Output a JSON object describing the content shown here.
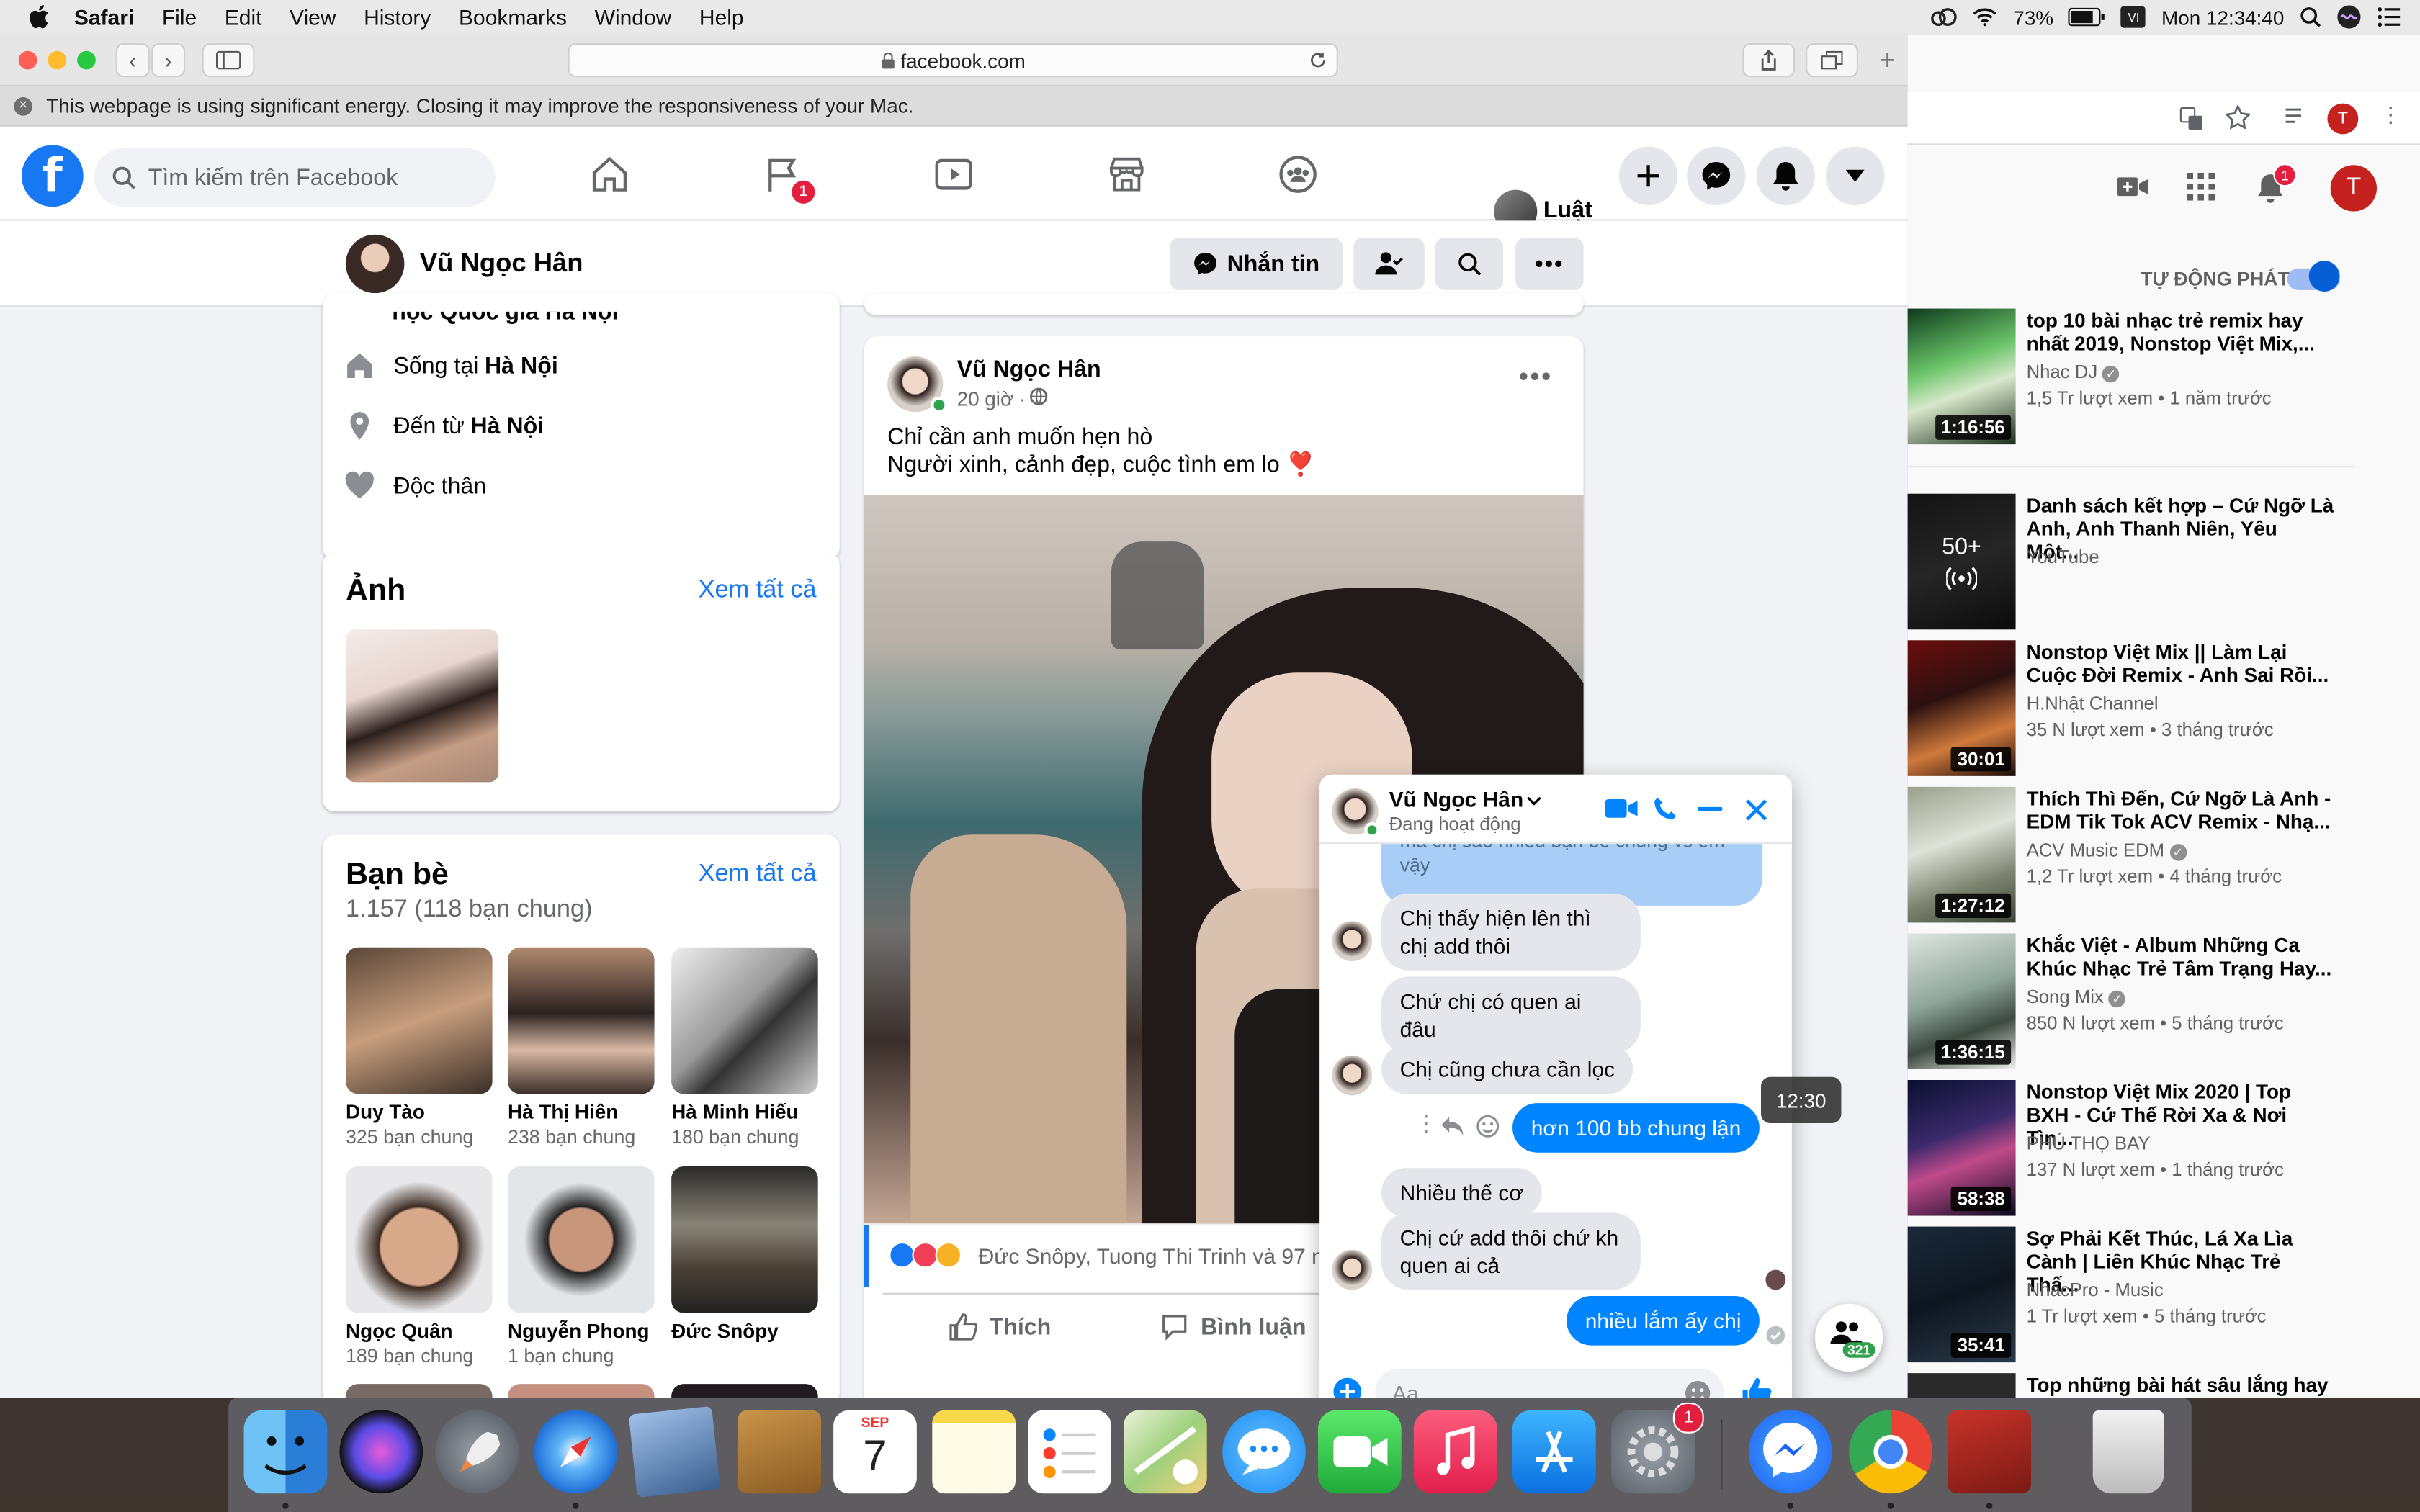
{
  "menubar": {
    "app": "Safari",
    "items": [
      "File",
      "Edit",
      "View",
      "History",
      "Bookmarks",
      "Window",
      "Help"
    ],
    "battery": "73%",
    "clock": "Mon 12:34:40"
  },
  "safari": {
    "url": "facebook.com",
    "energy_warning": "This webpage is using significant energy. Closing it may improve the responsiveness of your Mac."
  },
  "facebook": {
    "search_placeholder": "Tìm kiếm trên Facebook",
    "groups_badge": "1",
    "user_name": "Luật",
    "profile": {
      "name": "Vũ Ngọc Hân",
      "message_button": "Nhắn tin"
    },
    "intro": {
      "cut_line": "học Quốc gia Hà Nội",
      "lives_prefix": "Sống tại ",
      "lives_city": "Hà Nội",
      "from_prefix": "Đến từ ",
      "from_city": "Hà Nội",
      "relationship": "Độc thân"
    },
    "photos": {
      "title": "Ảnh",
      "see_all": "Xem tất cả"
    },
    "friends": {
      "title": "Bạn bè",
      "see_all": "Xem tất cả",
      "count": "1.157 (118 bạn chung)",
      "list": [
        {
          "name": "Duy Tào",
          "mutual": "325 bạn chung"
        },
        {
          "name": "Hà Thị Hiên",
          "mutual": "238 bạn chung"
        },
        {
          "name": "Hà Minh Hiếu",
          "mutual": "180 bạn chung"
        },
        {
          "name": "Ngọc Quân",
          "mutual": "189 bạn chung"
        },
        {
          "name": "Nguyễn Phong",
          "mutual": "1 bạn chung"
        },
        {
          "name": "Đức Snôpy",
          "mutual": ""
        }
      ]
    },
    "post": {
      "author": "Vũ Ngọc Hân",
      "time": "20 giờ ·",
      "line1": "Chỉ cần anh muốn hẹn hò",
      "line2": "Người xinh, cảnh đẹp, cuộc tình em lo ❣️",
      "reactions": "Đức Snôpy, Tuong Thi Trinh và 97 n",
      "like": "Thích",
      "comment": "Bình luận"
    }
  },
  "chat": {
    "name": "Vũ Ngọc Hân",
    "status": "Đang hoạt động",
    "cut_msg": "mà chị sao nhiều bạn bè chung vs em vậy",
    "messages": [
      {
        "dir": "in",
        "text": "Chị thấy hiện lên thì chị add thôi"
      },
      {
        "dir": "in",
        "text": "Chứ chị có quen ai đâu"
      },
      {
        "dir": "in",
        "text": "Chị cũng chưa cần lọc"
      },
      {
        "dir": "out",
        "text": "hơn 100 bb chung lận"
      },
      {
        "dir": "in",
        "text": "Nhiều thế cơ"
      },
      {
        "dir": "in",
        "text": "Chị cứ add thôi chứ kh quen ai cả"
      },
      {
        "dir": "out",
        "text": "nhiều lắm ấy chị"
      }
    ],
    "tooltip_time": "12:30",
    "input_placeholder": "Aa",
    "contacts_count": "321"
  },
  "youtube": {
    "autoplay_label": "TỰ ĐỘNG PHÁT",
    "notif_badge": "1",
    "avatar_letter": "T",
    "videos": [
      {
        "title": "top 10 bài nhạc trẻ remix hay nhất 2019, Nonstop Việt Mix,...",
        "channel": "Nhac DJ",
        "meta": "1,5 Tr lượt xem • 1 năm trước",
        "duration": "1:16:56",
        "verified": true
      },
      {
        "title": "Danh sách kết hợp – Cứ Ngỡ Là Anh, Anh Thanh Niên, Yêu Một...",
        "channel": "YouTube",
        "meta": "",
        "duration": "",
        "mix_count": "50+",
        "verified": false
      },
      {
        "title": "Nonstop Việt Mix || Làm Lại Cuộc Đời Remix - Anh Sai Rồi...",
        "channel": "H.Nhật Channel",
        "meta": "35 N lượt xem • 3 tháng trước",
        "duration": "30:01",
        "verified": false
      },
      {
        "title": "Thích Thì Đến, Cứ Ngỡ Là Anh - EDM Tik Tok ACV Remix - Nhạ...",
        "channel": "ACV Music EDM",
        "meta": "1,2 Tr lượt xem • 4 tháng trước",
        "duration": "1:27:12",
        "verified": true
      },
      {
        "title": "Khắc Việt - Album Những Ca Khúc Nhạc Trẻ Tâm Trạng Hay...",
        "channel": "Song Mix",
        "meta": "850 N lượt xem • 5 tháng trước",
        "duration": "1:36:15",
        "verified": true
      },
      {
        "title": "Nonstop Việt Mix 2020 | Top BXH - Cứ Thế Rời Xa & Nơi Tìn...",
        "channel": "PHÚ THỌ BAY",
        "meta": "137 N lượt xem • 1 tháng trước",
        "duration": "58:38",
        "verified": false
      },
      {
        "title": "Sợ Phải Kết Thúc, Lá Xa Lìa Cành | Liên Khúc Nhạc Trẻ Thấ...",
        "channel": "NhacPro - Music",
        "meta": "1 Tr lượt xem • 5 tháng trước",
        "duration": "35:41",
        "verified": false
      },
      {
        "title": "Top những bài hát sâu lắng hay",
        "channel": "",
        "meta": "",
        "duration": "",
        "verified": false
      }
    ]
  },
  "dock": {
    "calendar_month": "SEP",
    "calendar_day": "7",
    "prefs_badge": "1"
  }
}
